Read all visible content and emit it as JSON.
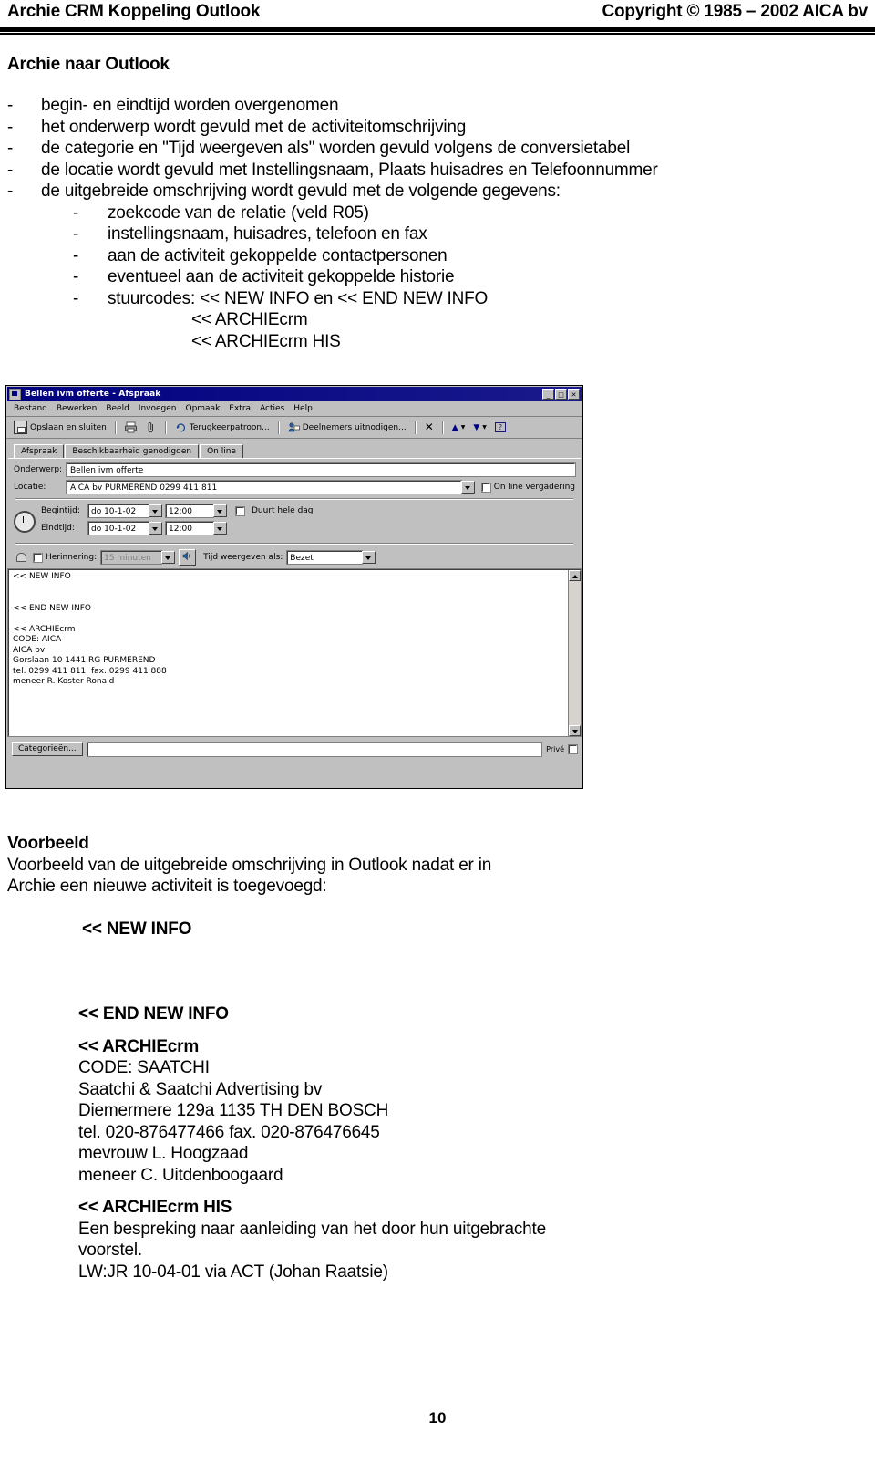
{
  "header": {
    "left": "Archie CRM Koppeling Outlook",
    "right": "Copyright © 1985 – 2002 AICA bv"
  },
  "section": {
    "title": "Archie naar Outlook",
    "bullets_level1": [
      "begin- en eindtijd worden overgenomen",
      "het onderwerp wordt gevuld met de activiteitomschrijving",
      "de categorie en \"Tijd weergeven als\" worden gevuld volgens de conversietabel",
      "de locatie wordt gevuld met Instellingsnaam, Plaats huisadres en Telefoonnummer",
      "de uitgebreide omschrijving wordt gevuld met de volgende gegevens:"
    ],
    "bullets_level2": [
      "zoekcode van de relatie (veld R05)",
      "instellingsnaam, huisadres, telefoon en fax",
      "aan de activiteit gekoppelde contactpersonen",
      "eventueel aan de activiteit gekoppelde historie",
      "stuurcodes: << NEW INFO en << END NEW INFO"
    ],
    "continuation": [
      "<< ARCHIEcrm",
      "<< ARCHIEcrm HIS"
    ],
    "dash": "-"
  },
  "outlook": {
    "title": "Bellen ivm offerte - Afspraak",
    "window_buttons": [
      "_",
      "□",
      "✕"
    ],
    "menu": [
      "Bestand",
      "Bewerken",
      "Beeld",
      "Invoegen",
      "Opmaak",
      "Extra",
      "Acties",
      "Help"
    ],
    "toolbar": {
      "save_close": "Opslaan en sluiten",
      "recurrence": "Terugkeerpatroon...",
      "invite": "Deelnemers uitnodigen...",
      "delete": "✕",
      "prev": "▲",
      "next": "▼",
      "help": "?"
    },
    "tabs": [
      "Afspraak",
      "Beschikbaarheid genodigden",
      "On line"
    ],
    "fields": {
      "subject_label": "Onderwerp:",
      "subject_value": "Bellen ivm offerte",
      "location_label": "Locatie:",
      "location_value": "AICA bv PURMEREND 0299 411 811",
      "online_meeting_label": "On line vergadering",
      "start_label": "Begintijd:",
      "start_date": "do 10-1-02",
      "start_time": "12:00",
      "allday_label": "Duurt hele dag",
      "end_label": "Eindtijd:",
      "end_date": "do 10-1-02",
      "end_time": "12:00",
      "reminder_label": "Herinnering:",
      "reminder_value": "15 minuten",
      "showtime_label": "Tijd weergeven als:",
      "showtime_value": "Bezet"
    },
    "body_text": "<< NEW INFO\n\n\n<< END NEW INFO\n\n<< ARCHIEcrm\nCODE: AICA\nAICA bv\nGorslaan 10 1441 RG PURMEREND\ntel. 0299 411 811  fax. 0299 411 888\nmeneer R. Koster Ronald",
    "bottom": {
      "categories_button": "Categorieën...",
      "categories_value": "",
      "private_label": "Privé"
    }
  },
  "voorbeeld": {
    "title": "Voorbeeld",
    "intro_line1": "Voorbeeld van de uitgebreide omschrijving in Outlook nadat er in",
    "intro_line2": "Archie een nieuwe activiteit is toegevoegd:",
    "new_info": "<< NEW INFO",
    "end_new_info": "<< END NEW INFO",
    "archiecrm_header": "<< ARCHIEcrm",
    "archiecrm_lines": [
      "CODE: SAATCHI",
      "Saatchi & Saatchi Advertising bv",
      "Diemermere 129a 1135 TH DEN BOSCH",
      "tel. 020-876477466 fax. 020-876476645",
      "mevrouw L. Hoogzaad",
      "meneer C. Uitdenboogaard"
    ],
    "his_header": "<< ARCHIEcrm HIS",
    "his_lines": [
      "Een bespreking naar aanleiding van het door hun uitgebrachte",
      "voorstel.",
      "LW:JR 10-04-01 via ACT (Johan Raatsie)"
    ]
  },
  "footer": {
    "page_number": "10"
  }
}
